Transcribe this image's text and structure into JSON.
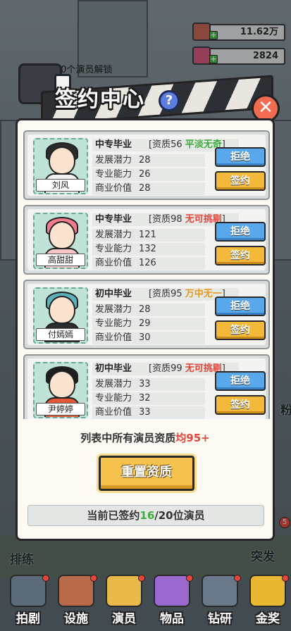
{
  "resources": [
    {
      "value": "11.62万",
      "color": "#c9604f"
    },
    {
      "value": "2824",
      "color": "#d9527a"
    }
  ],
  "background": {
    "unlock_text": "签约30个演员解锁",
    "left_labels": [
      "排练"
    ],
    "right_labels": [
      "突发"
    ],
    "side_badge": "5",
    "side_char": "粉"
  },
  "modal": {
    "title": "签约中心",
    "help_glyph": "?",
    "close_glyph": "✕"
  },
  "actors": [
    {
      "edu": "中专毕业",
      "aptitude_label": "资质56",
      "grade": "平淡无奇",
      "grade_color": "#3cae3c",
      "stats": [
        {
          "label": "发展潜力",
          "value": "28"
        },
        {
          "label": "专业能力",
          "value": "26"
        },
        {
          "label": "商业价值",
          "value": "28"
        }
      ],
      "name": "刘风",
      "hair_color": "#2c2c2c",
      "body_color": "#f2f2f2",
      "bg": "#bfe3d7"
    },
    {
      "edu": "中专毕业",
      "aptitude_label": "资质98",
      "grade": "无可挑剔",
      "grade_color": "#e5453a",
      "stats": [
        {
          "label": "发展潜力",
          "value": "121"
        },
        {
          "label": "专业能力",
          "value": "132"
        },
        {
          "label": "商业价值",
          "value": "126"
        }
      ],
      "name": "高甜甜",
      "hair_color": "#f27b8c",
      "body_color": "#f7c6c6",
      "bg": "#bfe3d7"
    },
    {
      "edu": "初中毕业",
      "aptitude_label": "资质95",
      "grade": "万中无一",
      "grade_color": "#e59a1e",
      "stats": [
        {
          "label": "发展潜力",
          "value": "28"
        },
        {
          "label": "专业能力",
          "value": "29"
        },
        {
          "label": "商业价值",
          "value": "30"
        }
      ],
      "name": "付嫣嫣",
      "hair_color": "#5dafb8",
      "body_color": "#2c2c2c",
      "bg": "#bfe3d7"
    },
    {
      "edu": "初中毕业",
      "aptitude_label": "资质99",
      "grade": "无可挑剔",
      "grade_color": "#e5453a",
      "stats": [
        {
          "label": "发展潜力",
          "value": "33"
        },
        {
          "label": "专业能力",
          "value": "32"
        },
        {
          "label": "商业价值",
          "value": "33"
        }
      ],
      "name": "尹婷婷",
      "hair_color": "#1e1e1e",
      "body_color": "#e05a3a",
      "bg": "#bfe3d7"
    }
  ],
  "buttons": {
    "reject": "拒绝",
    "sign": "签约"
  },
  "note": {
    "prefix": "列表中所有演员资质",
    "highlight": "均95+"
  },
  "reset_label": "重置资质",
  "signed": {
    "prefix": "当前已签约",
    "count": "16",
    "suffix": "/20位演员"
  },
  "nav": [
    {
      "label": "拍剧",
      "color": "#5c6b7a"
    },
    {
      "label": "设施",
      "color": "#b86a4a"
    },
    {
      "label": "演员",
      "color": "#e8b84a"
    },
    {
      "label": "物品",
      "color": "#9a6ad0"
    },
    {
      "label": "钻研",
      "color": "#6a7a8a"
    },
    {
      "label": "金奖",
      "color": "#e8b830"
    }
  ]
}
